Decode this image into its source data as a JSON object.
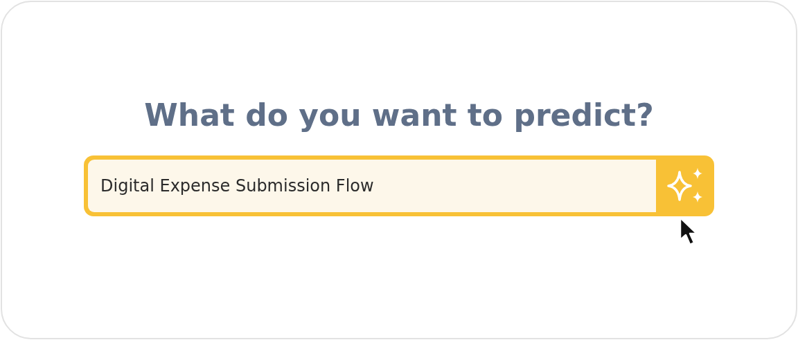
{
  "heading": "What do you want to predict?",
  "prompt": {
    "value": "Digital Expense Submission Flow"
  }
}
